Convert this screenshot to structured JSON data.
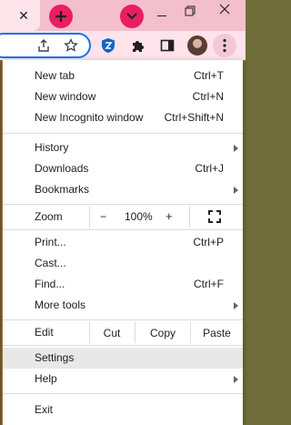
{
  "colors": {
    "tabstrip": "#f3bfcc",
    "toolbar": "#fde3ea",
    "accent_pink": "#e91e63",
    "omnibox_focus": "#1a73e8",
    "menu_bg": "#ffffff",
    "hover": "#e8e8e8"
  },
  "titlebar": {
    "tab_close_icon": "close-icon",
    "new_tab_icon": "plus-icon",
    "tab_search_icon": "chevron-down-icon"
  },
  "toolbar": {
    "icons": [
      "share-icon",
      "star-icon",
      "shield-extension-icon",
      "puzzle-icon",
      "side-panel-icon",
      "avatar",
      "kebab-menu-icon"
    ]
  },
  "menu": {
    "group1": [
      {
        "label": "New tab",
        "shortcut": "Ctrl+T"
      },
      {
        "label": "New window",
        "shortcut": "Ctrl+N"
      },
      {
        "label": "New Incognito window",
        "shortcut": "Ctrl+Shift+N"
      }
    ],
    "group2": [
      {
        "label": "History",
        "shortcut": ""
      },
      {
        "label": "Downloads",
        "shortcut": "Ctrl+J"
      },
      {
        "label": "Bookmarks",
        "shortcut": ""
      }
    ],
    "zoom": {
      "label": "Zoom",
      "minus": "−",
      "value": "100%",
      "plus": "+"
    },
    "group3": [
      {
        "label": "Print...",
        "shortcut": "Ctrl+P"
      },
      {
        "label": "Cast...",
        "shortcut": ""
      },
      {
        "label": "Find...",
        "shortcut": "Ctrl+F"
      },
      {
        "label": "More tools",
        "shortcut": ""
      }
    ],
    "edit": {
      "label": "Edit",
      "cut": "Cut",
      "copy": "Copy",
      "paste": "Paste"
    },
    "group4": [
      {
        "label": "Settings"
      },
      {
        "label": "Help"
      }
    ],
    "exit": {
      "label": "Exit"
    }
  }
}
